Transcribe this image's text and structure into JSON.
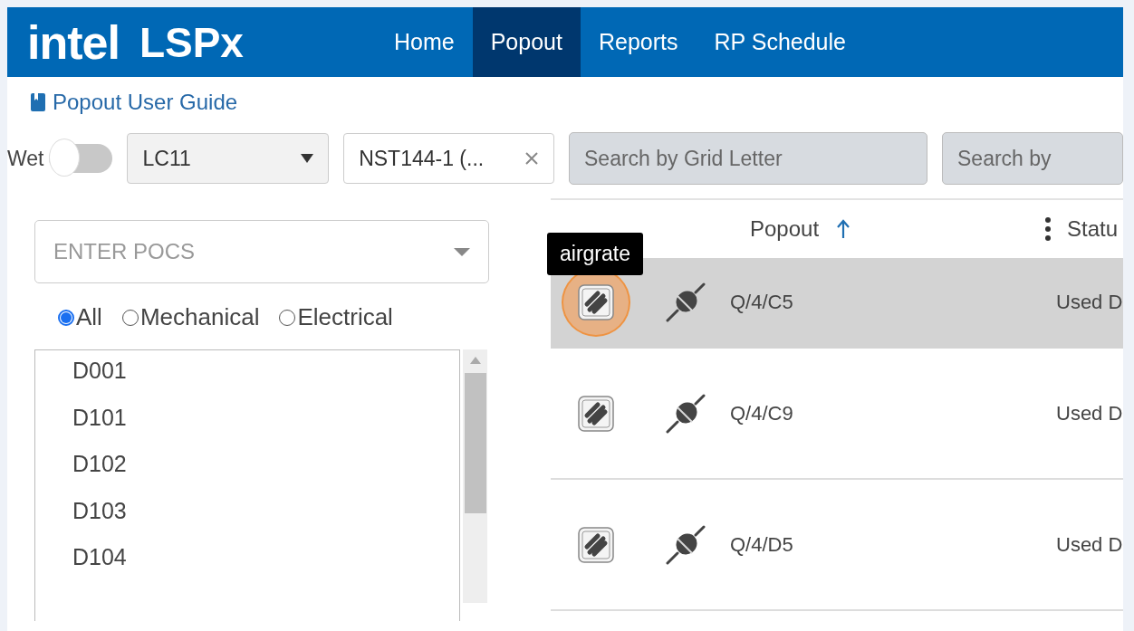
{
  "header": {
    "logo": "intel",
    "app_name": "LSPx",
    "nav": [
      {
        "label": "Home",
        "selected": false
      },
      {
        "label": "Popout",
        "selected": true
      },
      {
        "label": "Reports",
        "selected": false
      },
      {
        "label": "RP Schedule",
        "selected": false
      }
    ]
  },
  "guide_link": "Popout User Guide",
  "filters": {
    "wet": {
      "label": "Wet",
      "on": false
    },
    "area_select": {
      "value": "LC11"
    },
    "tool_select": {
      "value": "NST144-1 (..."
    },
    "grid_search": {
      "placeholder": "Search by Grid Letter"
    },
    "second_search": {
      "placeholder": "Search by"
    }
  },
  "pocs": {
    "placeholder": "ENTER POCS",
    "radios": [
      {
        "label": "All",
        "selected": true
      },
      {
        "label": "Mechanical",
        "selected": false
      },
      {
        "label": "Electrical",
        "selected": false
      }
    ],
    "items": [
      "D001",
      "D101",
      "D102",
      "D103",
      "D104"
    ]
  },
  "table": {
    "columns": [
      {
        "label": "Popout",
        "sorted_ascending": true
      },
      {
        "label": "Statu"
      }
    ],
    "rows": [
      {
        "popout": "Q/4/C5",
        "status": "Used D",
        "selected": true,
        "tooltip": "airgrate"
      },
      {
        "popout": "Q/4/C9",
        "status": "Used D",
        "selected": false
      },
      {
        "popout": "Q/4/D5",
        "status": "Used D",
        "selected": false
      }
    ]
  }
}
